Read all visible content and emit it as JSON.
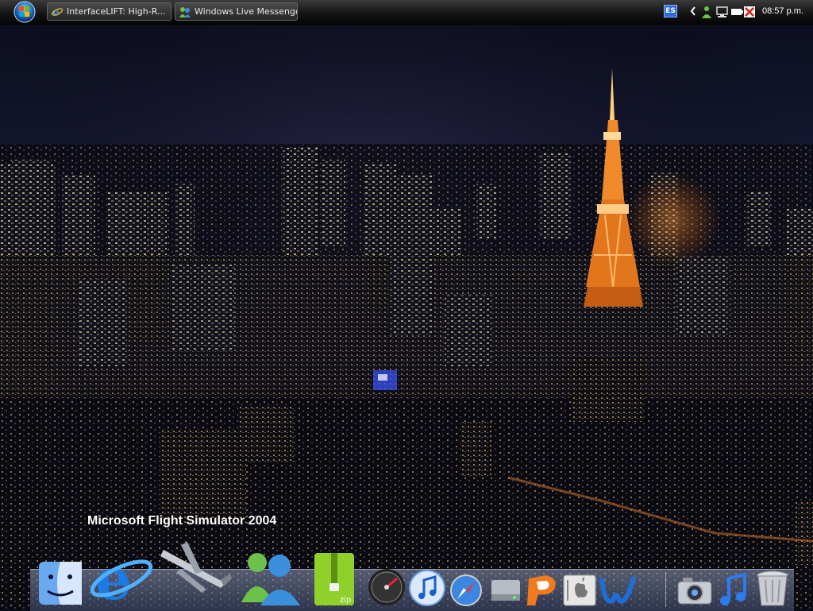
{
  "taskbar": {
    "tasks": [
      {
        "label": "InterfaceLIFT: High-R...",
        "icon": "internet-explorer-icon"
      },
      {
        "label": "Windows Live Messenger",
        "icon": "messenger-icon"
      }
    ]
  },
  "tray": {
    "language": "ES",
    "clock": "08:57 p.m.",
    "icons": [
      "chevron-left-icon",
      "messenger-status-icon",
      "network-icon",
      "battery-icon",
      "antivirus-icon"
    ]
  },
  "desktop": {
    "wallpaper": "tokyo-night-skyline-tower"
  },
  "dock": {
    "hover_label": "Microsoft Flight Simulator 2004",
    "items": [
      "finder-icon",
      "internet-explorer-icon",
      "flight-simulator-icon",
      "messenger-icon",
      "zip-archive-icon",
      "dashboard-icon",
      "itunes-icon",
      "safari-icon",
      "hard-drive-icon",
      "powerpoint-icon",
      "system-preferences-icon",
      "word-icon",
      "iphoto-camera-icon",
      "music-note-icon",
      "trash-icon"
    ]
  },
  "colors": {
    "taskbar": "#151515",
    "tower": "#f08a2a",
    "sky": "#0f1226"
  }
}
